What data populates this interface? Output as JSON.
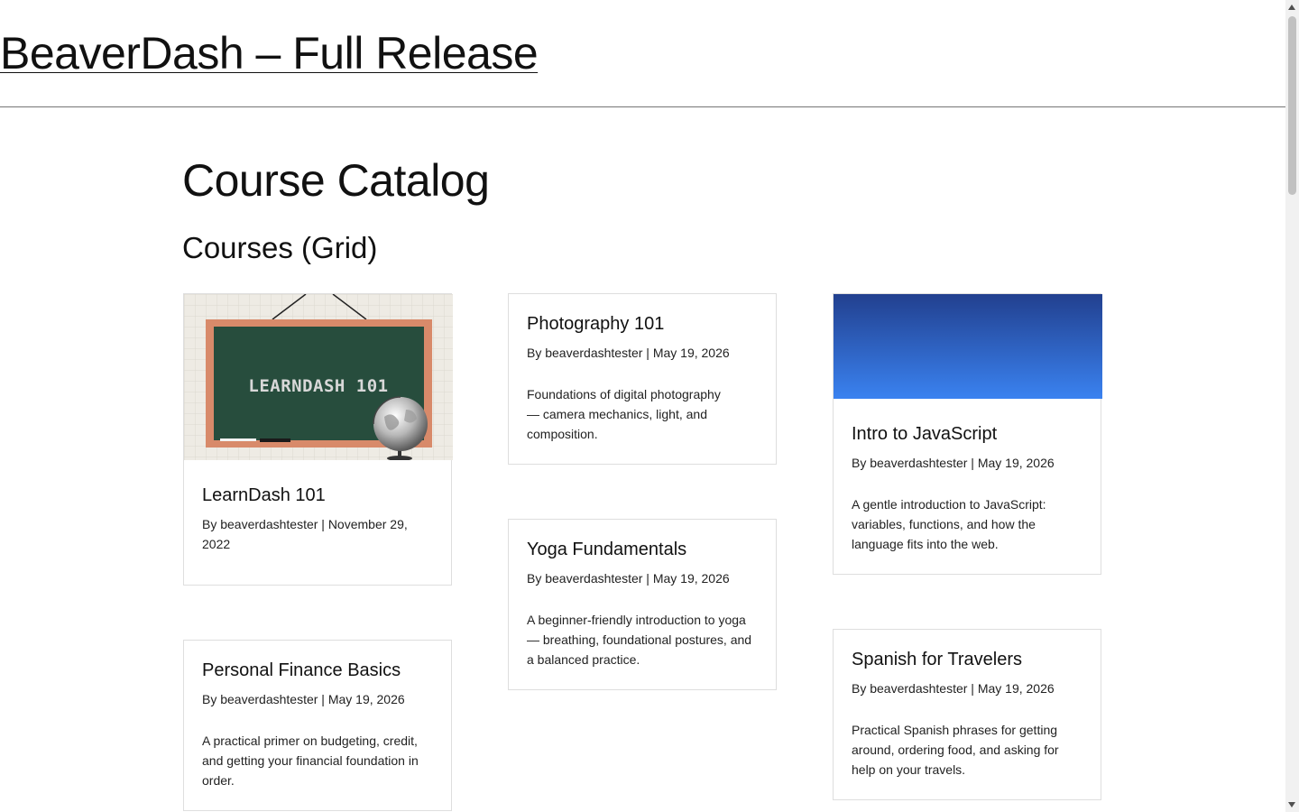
{
  "site": {
    "title": "BeaverDash – Full Release"
  },
  "page": {
    "title": "Course Catalog"
  },
  "section": {
    "title": "Courses (Grid)"
  },
  "courses": [
    {
      "title": "LearnDash 101",
      "meta": "By beaverdashtester | November 29, 2022",
      "description": "",
      "thumbnail_text": "LEARNDASH 101"
    },
    {
      "title": "Photography 101",
      "meta": "By beaverdashtester | May 19, 2026",
      "description": "Foundations of digital photography — camera mechanics, light, and composition."
    },
    {
      "title": "Intro to JavaScript",
      "meta": "By beaverdashtester | May 19, 2026",
      "description": "A gentle introduction to JavaScript: variables, functions, and how the language fits into the web."
    },
    {
      "title": "Yoga Fundamentals",
      "meta": "By beaverdashtester | May 19, 2026",
      "description": "A beginner-friendly introduction to yoga — breathing, foundational postures, and a balanced practice."
    },
    {
      "title": "Personal Finance Basics",
      "meta": "By beaverdashtester | May 19, 2026",
      "description": "A practical primer on budgeting, credit, and getting your financial foundation in order."
    },
    {
      "title": "Spanish for Travelers",
      "meta": "By beaverdashtester | May 19, 2026",
      "description": "Practical Spanish phrases for getting around, ordering food, and asking for help on your travels."
    }
  ]
}
